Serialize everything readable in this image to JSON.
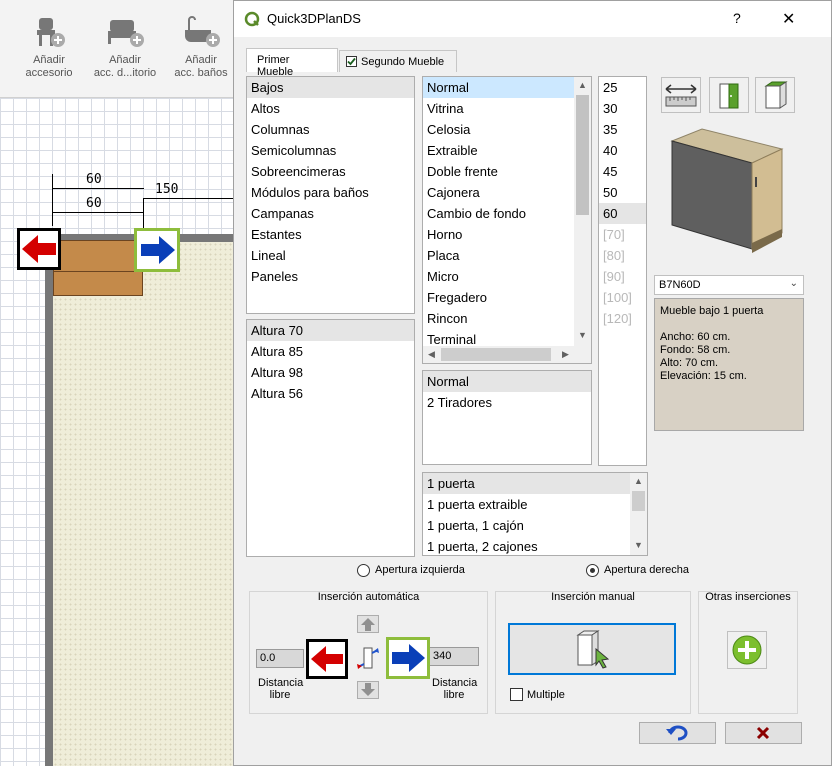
{
  "background_app": {
    "toolbar": [
      {
        "line1": "Añadir",
        "line2": "accesorio"
      },
      {
        "line1": "Añadir",
        "line2": "acc. d...itorio"
      },
      {
        "line1": "Añadir",
        "line2": "acc. baños"
      }
    ],
    "dimensions": [
      "60",
      "150",
      "60"
    ]
  },
  "dialog": {
    "title": "Quick3DPlanDS",
    "help": "?",
    "close": "✕",
    "tabs": [
      {
        "label": "Primer Mueble",
        "active": true
      },
      {
        "label": "Segundo Mueble",
        "checked": true
      }
    ],
    "categories": [
      "Bajos",
      "Altos",
      "Columnas",
      "Semicolumnas",
      "Sobreencimeras",
      "Módulos para baños",
      "Campanas",
      "Estantes",
      "Lineal",
      "Paneles"
    ],
    "categories_selected": "Bajos",
    "heights": [
      "Altura 70",
      "Altura 85",
      "Altura 98",
      "Altura 56"
    ],
    "types": [
      "Normal",
      "Vitrina",
      "Celosia",
      "Extraible",
      "Doble frente",
      "Cajonera",
      "Cambio de fondo",
      "Horno",
      "Placa",
      "Micro",
      "Fregadero",
      "Rincon",
      "Terminal"
    ],
    "handles": [
      "Normal",
      "2 Tiradores"
    ],
    "widths": [
      "25",
      "30",
      "35",
      "40",
      "45",
      "50",
      "60"
    ],
    "widths_disabled": [
      "[70]",
      "[80]",
      "[90]",
      "[100]",
      "[120]"
    ],
    "doors": [
      "1 puerta",
      "1 puerta extraible",
      "1 puerta, 1 cajón",
      "1 puerta, 2 cajones"
    ],
    "model_code": "B7N60D",
    "description": {
      "title": "Mueble bajo 1 puerta",
      "ancho": "Ancho: 60 cm.",
      "fondo": "Fondo: 58 cm.",
      "alto": "Alto: 70 cm.",
      "elevacion": "Elevación: 15 cm."
    },
    "opening": {
      "left": "Apertura izquierda",
      "right": "Apertura derecha",
      "selected": "right"
    },
    "auto_insert": {
      "title": "Inserción automática",
      "left_value": "0.0",
      "right_value": "340",
      "left_caption_1": "Distancia",
      "left_caption_2": "libre",
      "right_caption_1": "Distancia",
      "right_caption_2": "libre"
    },
    "manual_insert": {
      "title": "Inserción manual",
      "multiple": "Multiple"
    },
    "other_insert": {
      "title": "Otras inserciones"
    },
    "colors": {
      "accent_green": "#8ebd3c",
      "arrow_red": "#d40000",
      "arrow_blue": "#0a3fb8",
      "selection_blue": "#cce8ff"
    }
  }
}
